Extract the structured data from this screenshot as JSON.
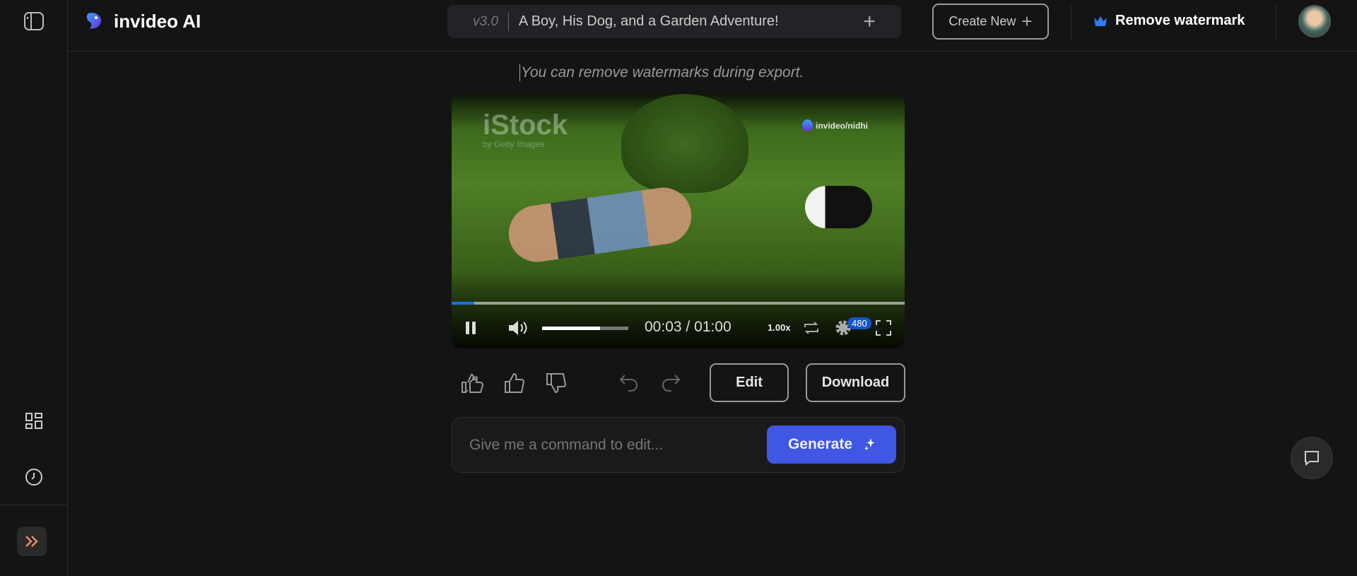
{
  "header": {
    "app_name": "invideo AI",
    "version": "v3.0",
    "project_title": "A Boy, His Dog, and a Garden Adventure!",
    "create_new_label": "Create New",
    "remove_watermark_label": "Remove watermark"
  },
  "main": {
    "hint": "You can remove watermarks during export.",
    "video": {
      "watermark_stock": "iStock",
      "watermark_stock_sub": "by Getty Images",
      "watermark_channel": "invideo/nidhi",
      "current_time": "00:03",
      "duration": "01:00",
      "time_separator": " / ",
      "speed": "1.00x",
      "quality": "480",
      "progress_fraction": 0.05,
      "volume_fraction": 0.67
    },
    "edit_label": "Edit",
    "download_label": "Download",
    "command_placeholder": "Give me a command to edit...",
    "generate_label": "Generate"
  },
  "colors": {
    "accent": "#3f57e3",
    "progress": "#1a6ef5",
    "crown": "#2f7cf6",
    "expand": "#f08a72"
  }
}
